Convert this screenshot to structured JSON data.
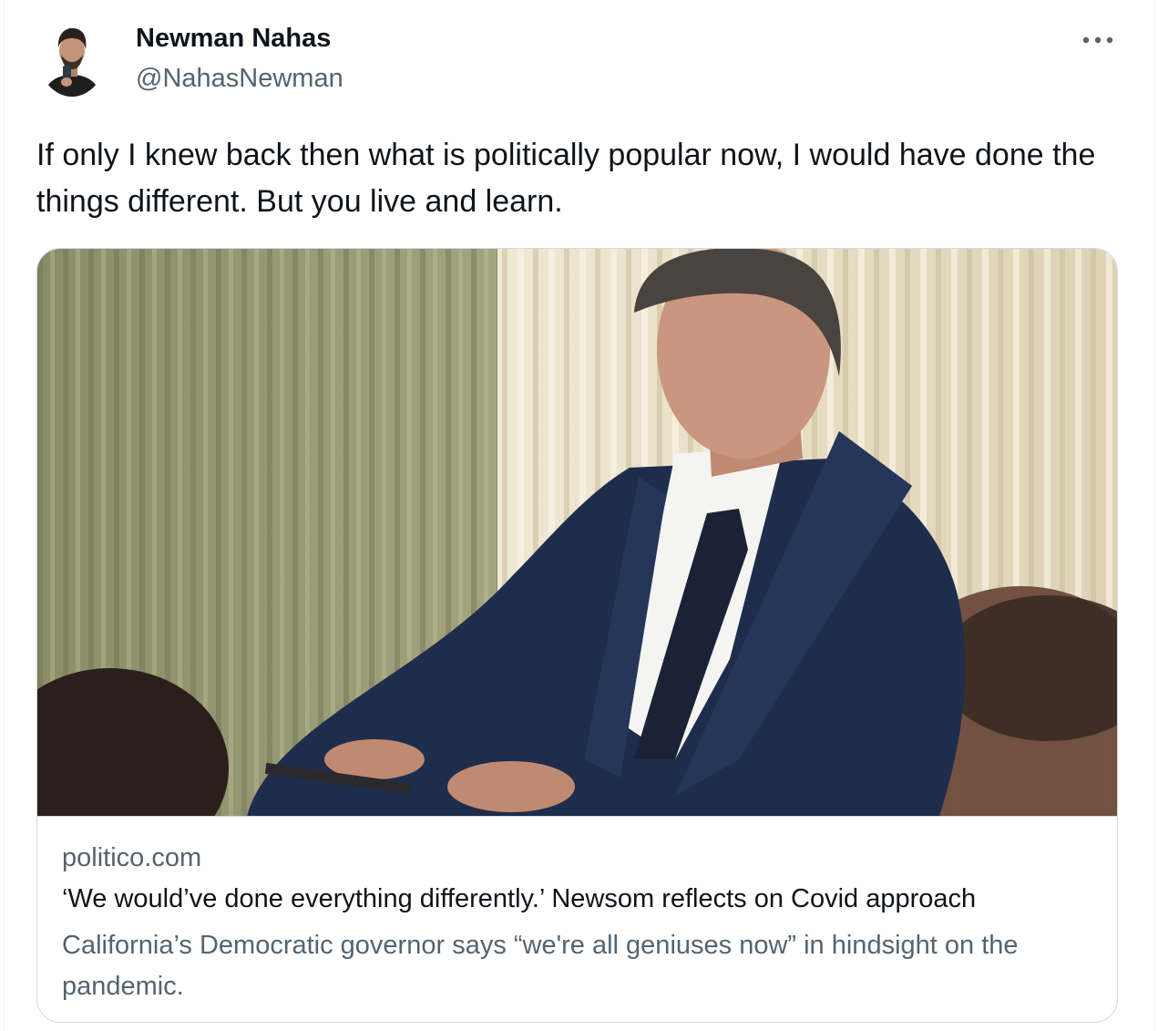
{
  "author": {
    "display_name": "Newman Nahas",
    "handle": "@NahasNewman",
    "avatar_icon": "profile-photo"
  },
  "more_icon": "more-horizontal-icon",
  "tweet": {
    "text": "If only I knew back then what is politically popular now, I would have done the things different. But you live and learn."
  },
  "link_card": {
    "image": "photo-man-in-suit-seated",
    "domain": "politico.com",
    "title": "‘We would’ve done everything differently.’ Newsom reflects on Covid approach",
    "description": "California’s Democratic governor says “we're all geniuses now” in hindsight on the pandemic."
  },
  "colors": {
    "text_primary": "#0f1419",
    "text_secondary": "#536471",
    "border": "#cfd9de"
  }
}
